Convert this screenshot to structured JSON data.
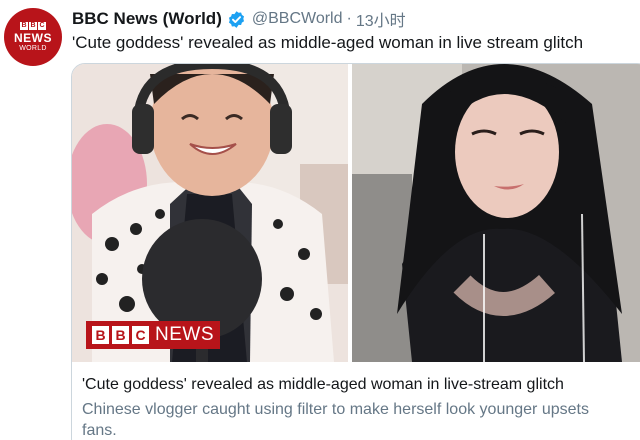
{
  "account": {
    "display_name": "BBC News (World)",
    "handle": "@BBCWorld",
    "separator": "·",
    "time": "13小时",
    "avatar": {
      "blocks": [
        "B",
        "B",
        "C"
      ],
      "line1": "NEWS",
      "line2": "WORLD",
      "background": "#b8141a"
    }
  },
  "tweet": {
    "text": "'Cute goddess' revealed as middle-aged woman in live stream glitch"
  },
  "card": {
    "logo": {
      "blocks": [
        "B",
        "B",
        "C"
      ],
      "word": "NEWS"
    },
    "title": "'Cute goddess' revealed as middle-aged woman in live-stream glitch",
    "description": "Chinese vlogger caught using filter to make herself look younger upsets fans."
  },
  "colors": {
    "bbc_red": "#b8141a",
    "verified_blue": "#1da1f2",
    "secondary_text": "#657786",
    "border": "#ccd6dd"
  },
  "icons": {
    "verified": "verified-badge-icon"
  }
}
